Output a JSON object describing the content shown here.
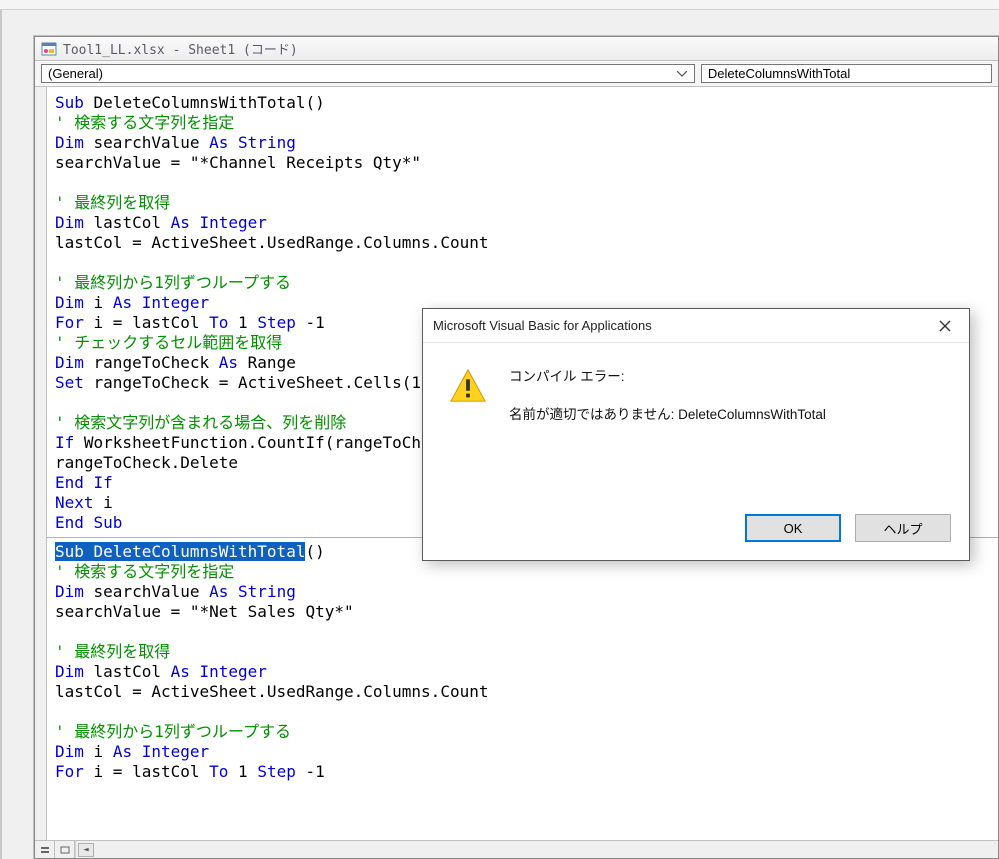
{
  "toolbar": {
    "status_text": ""
  },
  "window": {
    "title": "Tool1_LL.xlsx - Sheet1 (コード)"
  },
  "dropdowns": {
    "object": "(General)",
    "procedure": "DeleteColumnsWithTotal"
  },
  "code": {
    "block1": {
      "l1a": "Sub",
      "l1b": " DeleteColumnsWithTotal()",
      "l2": "' 検索する文字列を指定",
      "l3a": "Dim",
      "l3b": " searchValue ",
      "l3c": "As String",
      "l4": "searchValue = \"*Channel Receipts Qty*\"",
      "l5": "",
      "l6": "' 最終列を取得",
      "l7a": "Dim",
      "l7b": " lastCol ",
      "l7c": "As Integer",
      "l8": "lastCol = ActiveSheet.UsedRange.Columns.Count",
      "l9": "",
      "l10": "' 最終列から1列ずつループする",
      "l11a": "Dim",
      "l11b": " i ",
      "l11c": "As Integer",
      "l12a": "For",
      "l12b": " i = lastCol ",
      "l12c": "To",
      "l12d": " 1 ",
      "l12e": "Step",
      "l12f": " -1",
      "l13": "' チェックするセル範囲を取得",
      "l14a": "Dim",
      "l14b": " rangeToCheck ",
      "l14c": "As",
      "l14d": " Range",
      "l15a": "Set",
      "l15b": " rangeToCheck = ActiveSheet.Cells(1",
      "l16": "",
      "l17": "' 検索文字列が含まれる場合、列を削除",
      "l18a": "If",
      "l18b": " WorksheetFunction.CountIf(rangeToCh",
      "l19": "rangeToCheck.Delete",
      "l20": "End If",
      "l21a": "Next",
      "l21b": " i",
      "l22": "End Sub"
    },
    "block2": {
      "l1": "Sub DeleteColumnsWithTotal",
      "l1b": "()",
      "l2": "' 検索する文字列を指定",
      "l3a": "Dim",
      "l3b": " searchValue ",
      "l3c": "As String",
      "l4": "searchValue = \"*Net Sales Qty*\"",
      "l5": "",
      "l6": "' 最終列を取得",
      "l7a": "Dim",
      "l7b": " lastCol ",
      "l7c": "As Integer",
      "l8": "lastCol = ActiveSheet.UsedRange.Columns.Count",
      "l9": "",
      "l10": "' 最終列から1列ずつループする",
      "l11a": "Dim",
      "l11b": " i ",
      "l11c": "As Integer",
      "l12a": "For",
      "l12b": " i = lastCol ",
      "l12c": "To",
      "l12d": " 1 ",
      "l12e": "Step",
      "l12f": " -1"
    }
  },
  "dialog": {
    "title": "Microsoft Visual Basic for Applications",
    "error_label": "コンパイル エラー:",
    "error_msg": "名前が適切ではありません: DeleteColumnsWithTotal",
    "ok": "OK",
    "help": "ヘルプ"
  }
}
